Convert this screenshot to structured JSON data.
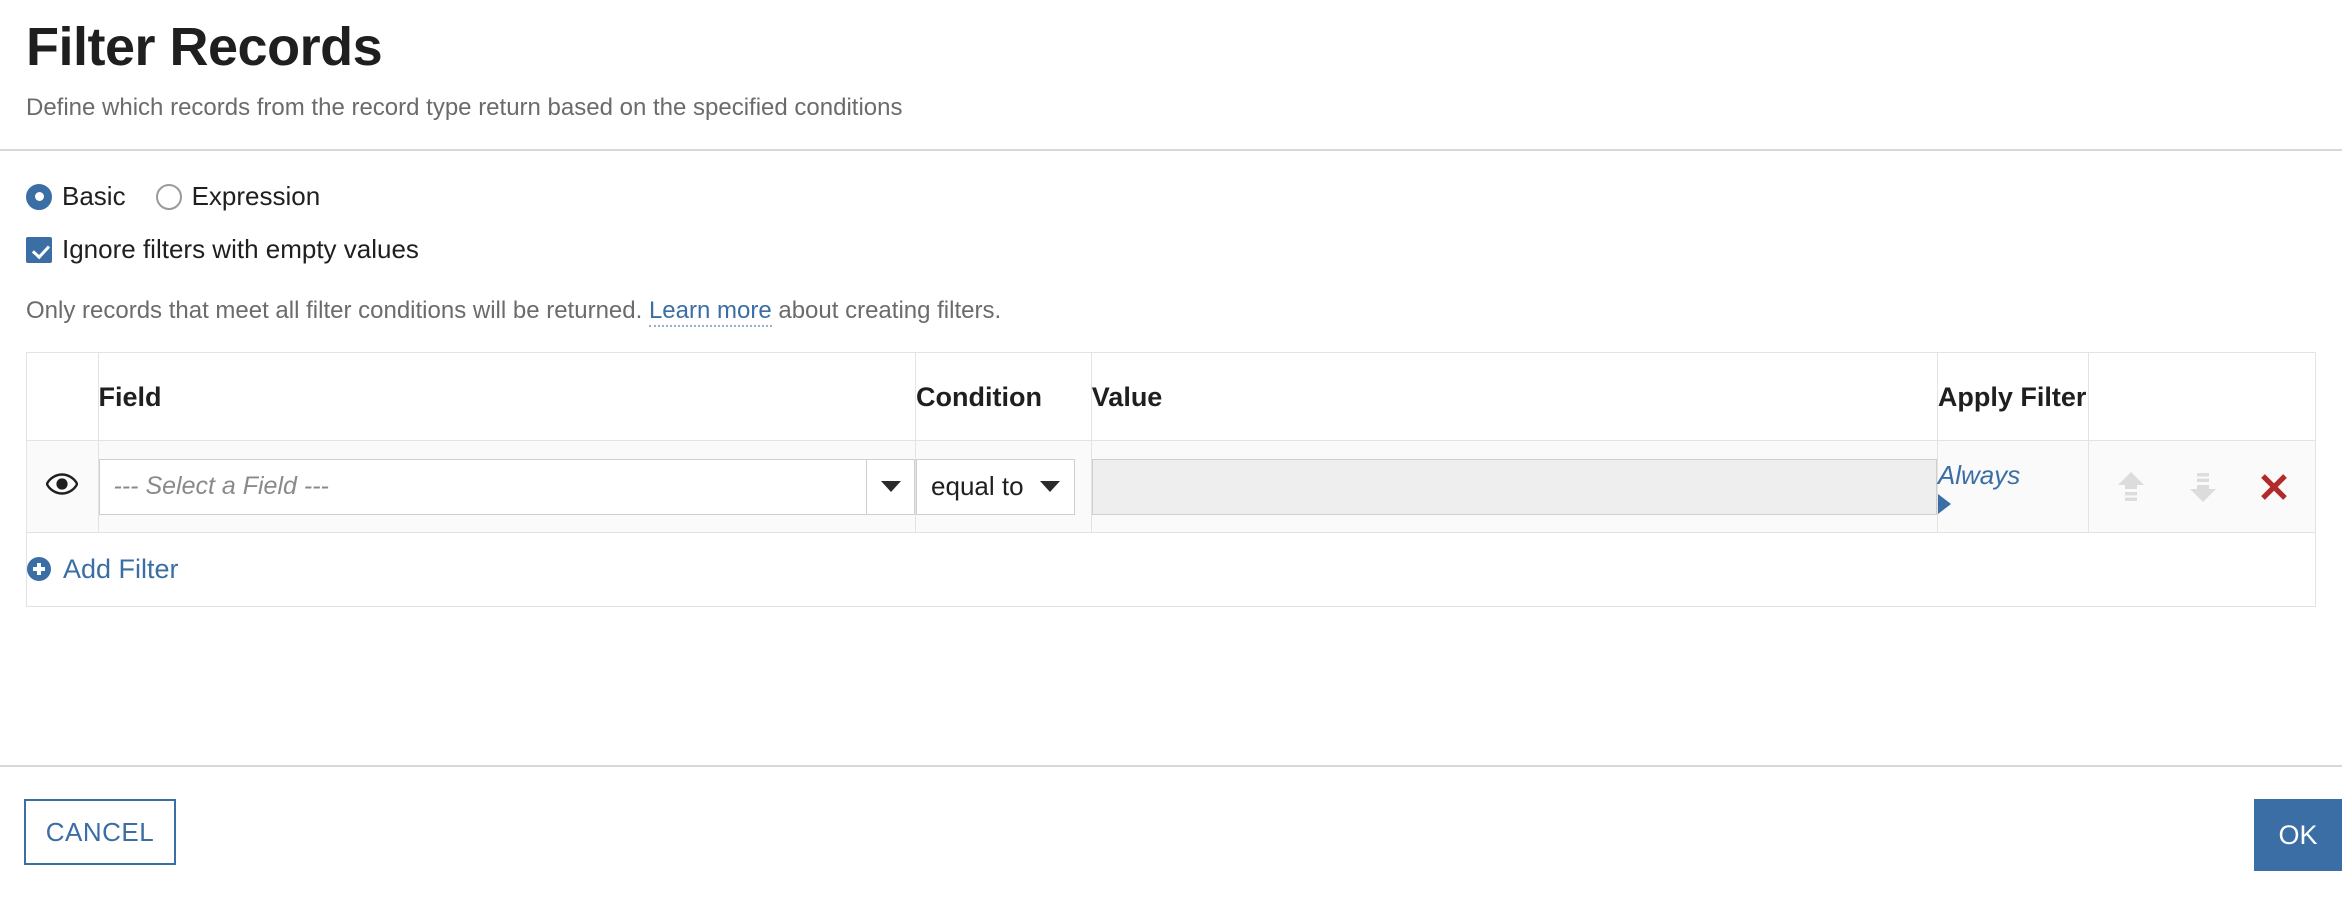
{
  "header": {
    "title": "Filter Records",
    "subtitle": "Define which records from the record type return based on the specified conditions"
  },
  "options": {
    "mode_radios": [
      {
        "label": "Basic",
        "selected": true
      },
      {
        "label": "Expression",
        "selected": false
      }
    ],
    "ignore_empty": {
      "label": "Ignore filters with empty values",
      "checked": true
    },
    "help_text_before": "Only records that meet all filter conditions will be returned. ",
    "help_link": "Learn more",
    "help_text_after": " about creating filters."
  },
  "table": {
    "columns": [
      "",
      "Field",
      "Condition",
      "Value",
      "Apply Filter",
      ""
    ],
    "rows": [
      {
        "visibility_icon": "eye-icon",
        "field_placeholder": "--- Select a Field ---",
        "condition": "equal to",
        "value": "",
        "value_placeholder": "",
        "apply_filter": "Always",
        "actions": [
          "move-up-icon",
          "move-down-icon",
          "delete-icon"
        ]
      }
    ],
    "add_filter_label": "Add Filter"
  },
  "footer": {
    "cancel_label": "CANCEL",
    "ok_label": "OK"
  },
  "colors": {
    "accent": "#3b6ea5",
    "delete": "#b22b2b",
    "disabled_icon": "#dcdcdc",
    "muted_text": "#6b6b6b",
    "border": "#e3e3e3"
  }
}
